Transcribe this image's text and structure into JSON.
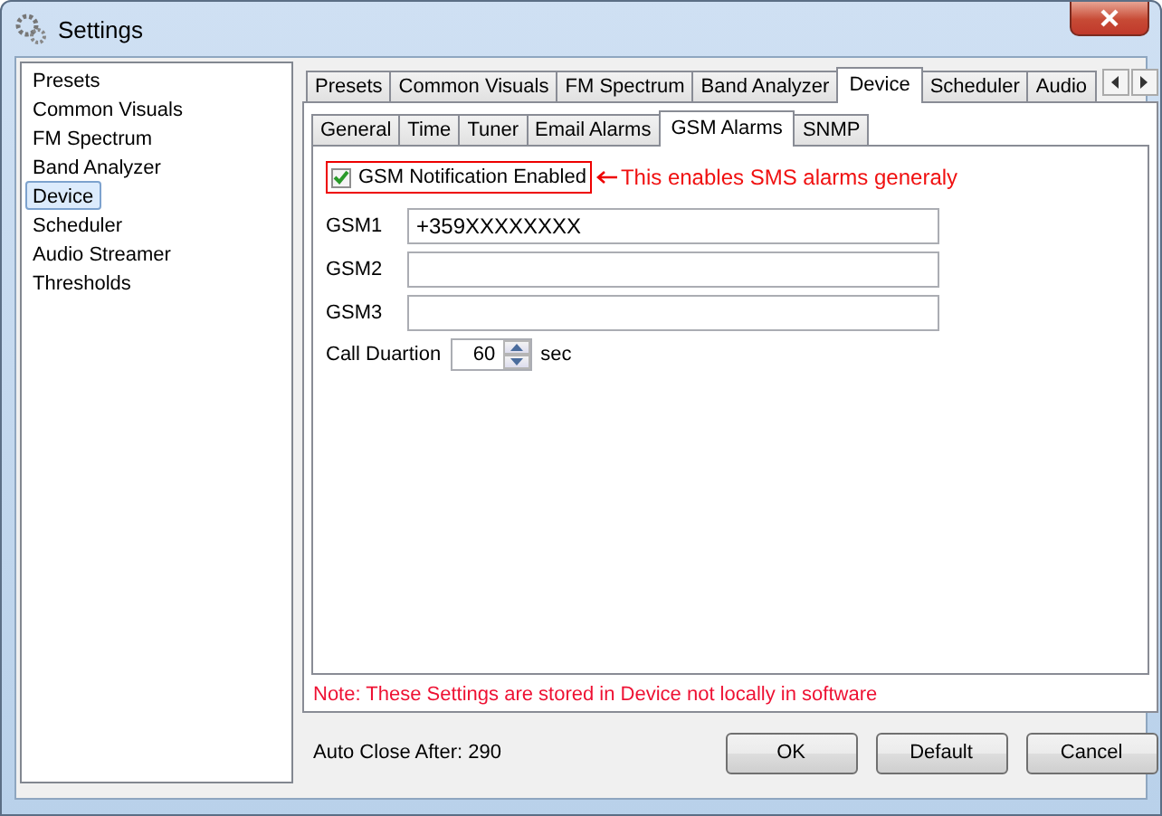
{
  "window": {
    "title": "Settings"
  },
  "sidebar": {
    "items": [
      {
        "label": "Presets",
        "selected": false
      },
      {
        "label": "Common Visuals",
        "selected": false
      },
      {
        "label": "FM Spectrum",
        "selected": false
      },
      {
        "label": "Band Analyzer",
        "selected": false
      },
      {
        "label": "Device",
        "selected": true
      },
      {
        "label": "Scheduler",
        "selected": false
      },
      {
        "label": "Audio Streamer",
        "selected": false
      },
      {
        "label": "Thresholds",
        "selected": false
      }
    ]
  },
  "tabs": [
    {
      "label": "Presets",
      "selected": false
    },
    {
      "label": "Common Visuals",
      "selected": false
    },
    {
      "label": "FM Spectrum",
      "selected": false
    },
    {
      "label": "Band Analyzer",
      "selected": false
    },
    {
      "label": "Device",
      "selected": true
    },
    {
      "label": "Scheduler",
      "selected": false
    },
    {
      "label": "Audio",
      "selected": false
    }
  ],
  "subtabs": [
    {
      "label": "General",
      "selected": false
    },
    {
      "label": "Time",
      "selected": false
    },
    {
      "label": "Tuner",
      "selected": false
    },
    {
      "label": "Email Alarms",
      "selected": false
    },
    {
      "label": "GSM Alarms",
      "selected": true
    },
    {
      "label": "SNMP",
      "selected": false
    }
  ],
  "gsm_notification": {
    "label": "GSM Notification Enabled",
    "checked": true,
    "annotation": "This enables SMS alarms generaly"
  },
  "fields": [
    {
      "label": "GSM1",
      "value": "+359XXXXXXXX"
    },
    {
      "label": "GSM2"
    },
    {
      "label": "GSM3"
    }
  ],
  "call_duration": {
    "label": "Call Duartion",
    "value": "60",
    "unit": "sec"
  },
  "note": "Note: These Settings are stored in Device not locally in software",
  "auto_close": "Auto Close After: 290",
  "buttons": [
    "OK",
    "Default",
    "Cancel"
  ]
}
